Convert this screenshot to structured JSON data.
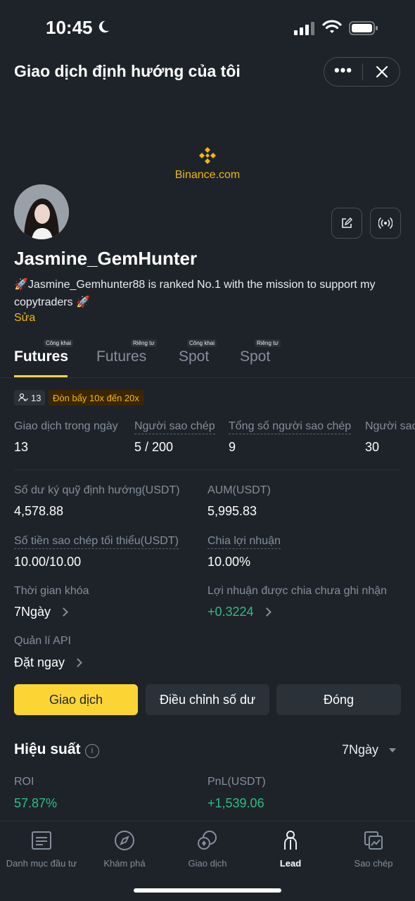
{
  "status_bar": {
    "time": "10:45"
  },
  "header": {
    "title": "Giao dịch định hướng của tôi"
  },
  "watermark": {
    "text": "Binance.com"
  },
  "profile": {
    "username": "Jasmine_GemHunter",
    "bio": "🚀Jasmine_Gemhunter88 is ranked No.1 with the mission to support my copytraders 🚀",
    "edit_label": "Sửa"
  },
  "tabs": [
    {
      "label": "Futures",
      "tag": "Công khai",
      "active": true
    },
    {
      "label": "Futures",
      "tag": "Riêng tư",
      "active": false
    },
    {
      "label": "Spot",
      "tag": "Công khai",
      "active": false
    },
    {
      "label": "Spot",
      "tag": "Riêng tư",
      "active": false
    }
  ],
  "badges": {
    "count": "13",
    "leverage": "Đòn bẩy 10x đến 20x"
  },
  "stats_row": [
    {
      "label": "Giao dịch trong ngày",
      "value": "13"
    },
    {
      "label": "Người sao chép",
      "value": "5 / 200"
    },
    {
      "label": "Tổng số người sao chép",
      "value": "9"
    },
    {
      "label": "Người sao",
      "value": "30"
    }
  ],
  "details": {
    "balance_label": "Số dư ký quỹ định hướng(USDT)",
    "balance_value": "4,578.88",
    "aum_label": "AUM(USDT)",
    "aum_value": "5,995.83",
    "min_copy_label": "Số tiền sao chép tối thiểu(USDT)",
    "min_copy_value": "10.00/10.00",
    "profit_share_label": "Chia lợi nhuận",
    "profit_share_value": "10.00%",
    "lock_label": "Thời gian khóa",
    "lock_value": "7Ngày",
    "unrealized_label": "Lợi nhuận được chia chưa ghi nhận",
    "unrealized_value": "+0.3224",
    "api_label": "Quản lí API",
    "api_value": "Đặt ngay"
  },
  "actions": {
    "trade": "Giao dịch",
    "adjust_balance": "Điều chỉnh số dư",
    "close": "Đóng"
  },
  "performance": {
    "title": "Hiệu suất",
    "period": "7Ngày",
    "roi_label": "ROI",
    "roi_value": "57.87%",
    "pnl_label": "PnL(USDT)",
    "pnl_value": "+1,539.06"
  },
  "bottom_nav": [
    {
      "label": "Danh mục đầu tư",
      "icon": "portfolio-icon"
    },
    {
      "label": "Khám phá",
      "icon": "compass-icon"
    },
    {
      "label": "Giao dịch",
      "icon": "trade-icon"
    },
    {
      "label": "Lead",
      "icon": "lead-icon",
      "active": true
    },
    {
      "label": "Sao chép",
      "icon": "copy-icon"
    }
  ],
  "colors": {
    "background": "#1e2329",
    "accent": "#f0b90b",
    "button_primary": "#fcd535",
    "positive": "#2ebd85",
    "muted": "#848e9c"
  }
}
